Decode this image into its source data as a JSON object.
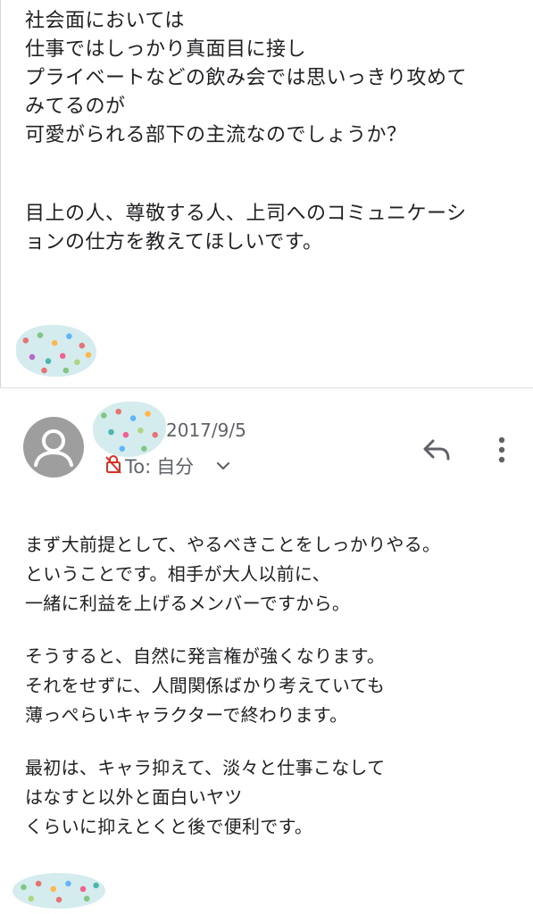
{
  "quoted_message": {
    "lines": [
      "社会面においては",
      "仕事ではしっかり真面目に接し",
      "プライベートなどの飲み会では思いっきり攻めて",
      "みてるのが",
      "可愛がられる部下の主流なのでしょうか？"
    ],
    "lines2": [
      "目上の人、尊敬する人、上司へのコミュニケーシ",
      "ョンの仕方を教えてほしいです。"
    ]
  },
  "message_header": {
    "date": "2017/9/5",
    "to_label": "To:",
    "recipient": "自分"
  },
  "icons": {
    "avatar": "person-icon",
    "lock": "lock-off-icon",
    "chevron": "chevron-down-icon",
    "reply": "reply-icon",
    "more": "more-vert-icon"
  },
  "reply_message": {
    "paragraphs": [
      [
        "まず大前提として、やるべきことをしっかりやる。",
        "ということです。相手が大人以前に、",
        "一緒に利益を上げるメンバーですから。"
      ],
      [
        "そうすると、自然に発言権が強くなります。",
        "それをせずに、人間関係ばかり考えていても",
        "薄っぺらいキャラクターで終わります。"
      ],
      [
        "最初は、キャラ抑えて、淡々と仕事こなして",
        "はなすと以外と面白いヤツ",
        "くらいに抑えとくと後で便利です。"
      ]
    ]
  },
  "colors": {
    "text": "#202124",
    "secondary_text": "#5f6368",
    "avatar_bg": "#9e9e9e",
    "lock_red": "#d93025"
  }
}
